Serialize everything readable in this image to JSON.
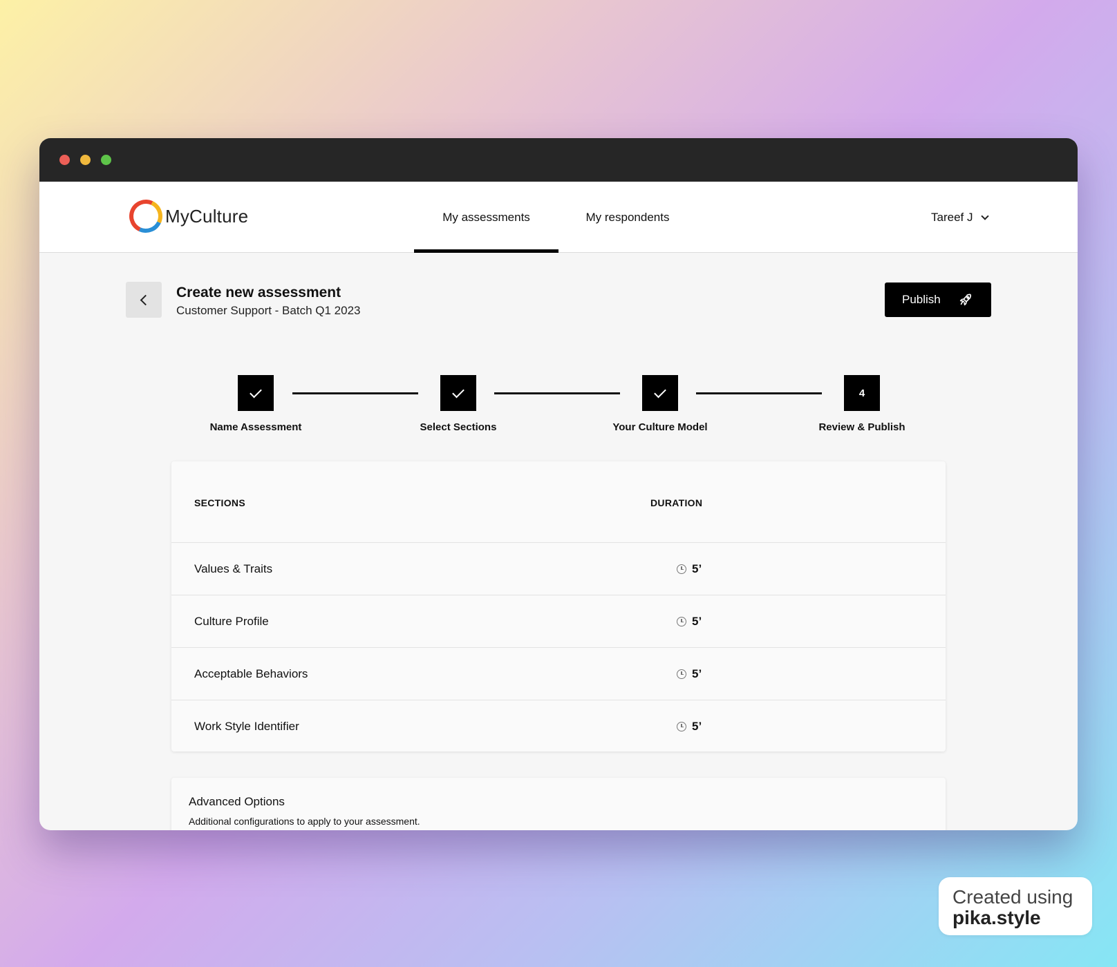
{
  "app": {
    "logo_text": "MyCulture"
  },
  "nav": {
    "tabs": [
      {
        "label": "My assessments",
        "active": true
      },
      {
        "label": "My respondents",
        "active": false
      }
    ],
    "user_name": "Tareef J"
  },
  "header": {
    "title": "Create new assessment",
    "subtitle": "Customer Support - Batch Q1 2023",
    "publish_label": "Publish"
  },
  "stepper": {
    "steps": [
      {
        "label": "Name Assessment",
        "state": "done"
      },
      {
        "label": "Select Sections",
        "state": "done"
      },
      {
        "label": "Your Culture Model",
        "state": "done"
      },
      {
        "label": "Review & Publish",
        "state": "current",
        "number": "4"
      }
    ]
  },
  "sections_table": {
    "headers": {
      "sections": "SECTIONS",
      "duration": "DURATION"
    },
    "rows": [
      {
        "name": "Values & Traits",
        "duration": "5’"
      },
      {
        "name": "Culture Profile",
        "duration": "5’"
      },
      {
        "name": "Acceptable Behaviors",
        "duration": "5’"
      },
      {
        "name": "Work Style Identifier",
        "duration": "5’"
      }
    ]
  },
  "advanced": {
    "title": "Advanced Options",
    "subtitle": "Additional configurations to apply to your assessment."
  },
  "badge": {
    "line1": "Created using",
    "line2": "pika.style"
  },
  "colors": {
    "accent": "#000000",
    "titlebar": "#262626",
    "background": "#f6f6f6"
  }
}
